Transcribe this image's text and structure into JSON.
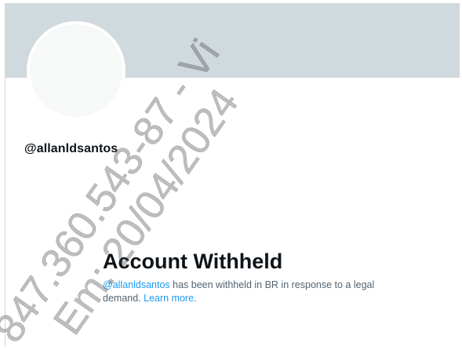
{
  "profile": {
    "handle": "@allanldsantos",
    "banner_color": "#cfd9de",
    "avatar_color": "#f7f9f9"
  },
  "withheld": {
    "title": "Account Withheld",
    "handle_link": "@allanldsantos",
    "message_middle": " has been withheld in BR in response to a legal demand. ",
    "learn_more": "Learn more",
    "period": "."
  },
  "watermark": {
    "line1": "847.360.543-87 - Vi",
    "line2": "Em: 20/04/2024"
  },
  "colors": {
    "link": "#1d9bf0",
    "text": "#0f1419",
    "muted": "#536471"
  }
}
